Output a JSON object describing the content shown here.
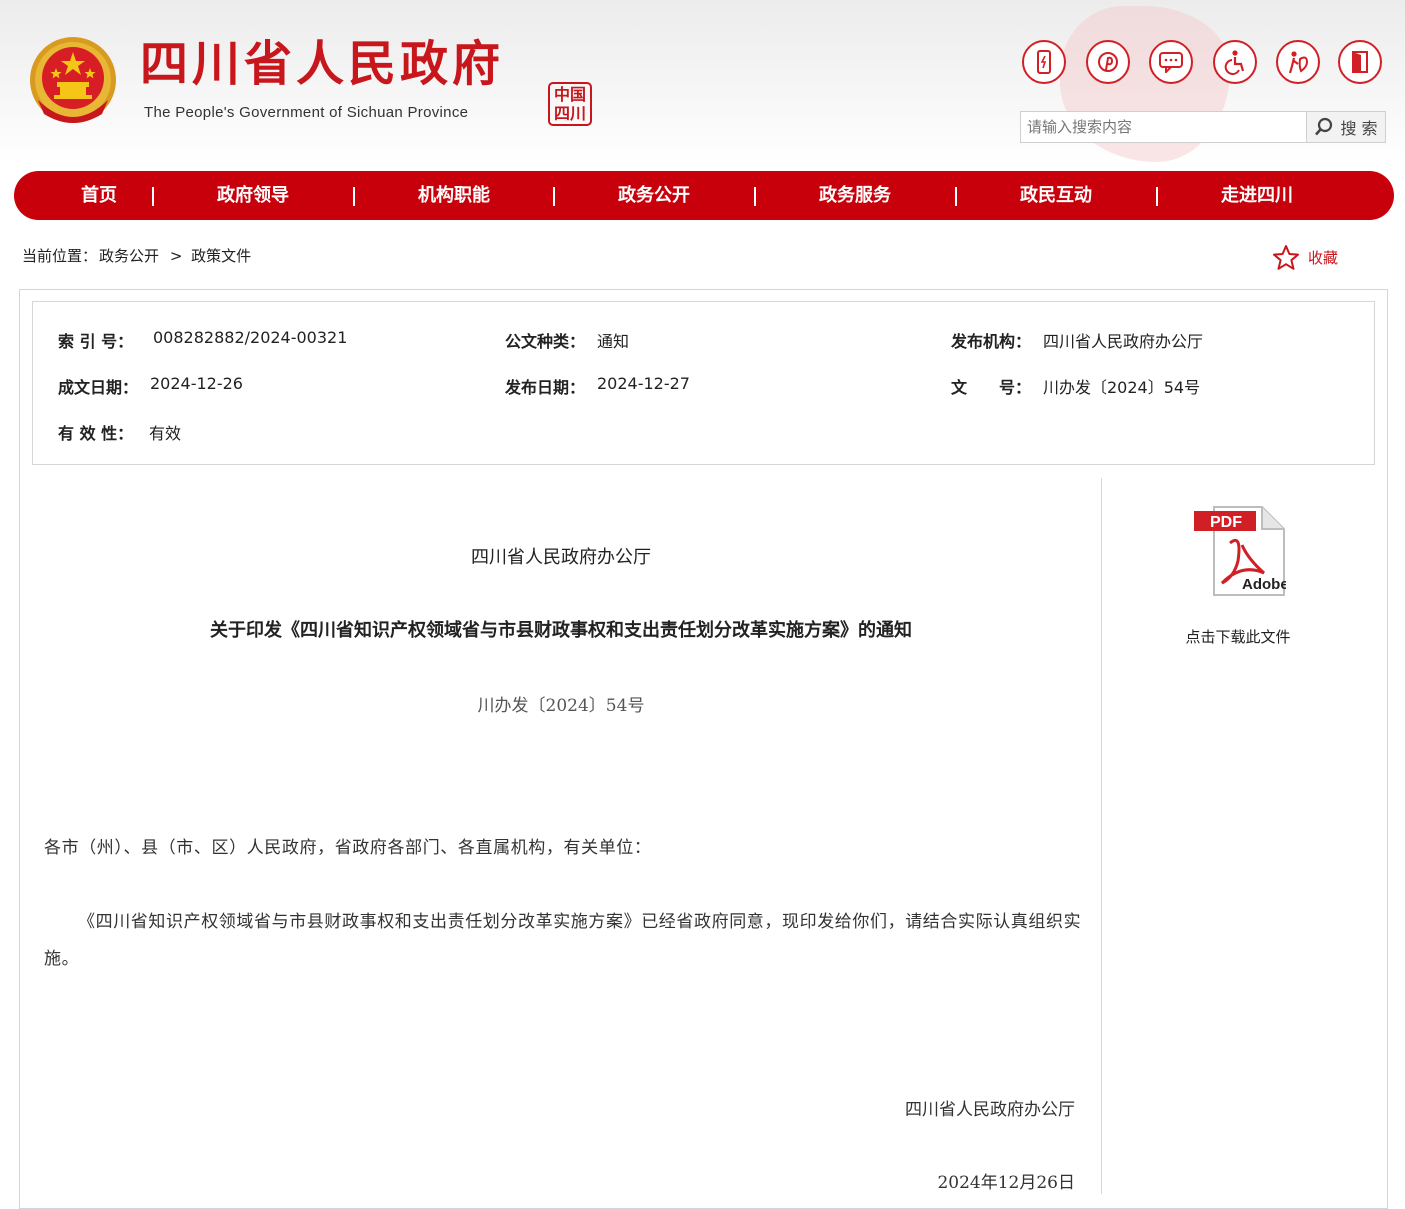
{
  "header": {
    "title": "四川省人民政府",
    "subtitle": "The People's Government of Sichuan Province",
    "seal_text": [
      "中国",
      "四川"
    ],
    "tool_icons": [
      "mobile-icon",
      "pinterest-icon",
      "message-icon",
      "accessibility-icon",
      "elderly-care-icon",
      "exit-door-icon"
    ],
    "search": {
      "placeholder": "请输入搜索内容",
      "button_label": "搜 索"
    },
    "accent_color": "#c8000b"
  },
  "nav": {
    "items": [
      {
        "label": "首页"
      },
      {
        "label": "政府领导"
      },
      {
        "label": "机构职能"
      },
      {
        "label": "政务公开"
      },
      {
        "label": "政务服务"
      },
      {
        "label": "政民互动"
      },
      {
        "label": "走进四川"
      }
    ],
    "separator": "|"
  },
  "breadcrumb": {
    "prefix": "当前位置：",
    "items": [
      "政务公开",
      "政策文件"
    ],
    "separator": ">"
  },
  "favorite": {
    "label": "收藏"
  },
  "meta": {
    "index_label": "索 引 号：",
    "index_value": "008282882/2024-00321",
    "type_label": "公文种类：",
    "type_value": "通知",
    "issuer_label": "发布机构：",
    "issuer_value": "四川省人民政府办公厅",
    "created_label": "成文日期：",
    "created_value": "2024-12-26",
    "published_label": "发布日期：",
    "published_value": "2024-12-27",
    "docno_label": "文　　号：",
    "docno_value": "川办发〔2024〕54号",
    "validity_label": "有 效 性：",
    "validity_value": "有效"
  },
  "document": {
    "issuer": "四川省人民政府办公厅",
    "title": "关于印发《四川省知识产权领域省与市县财政事权和支出责任划分改革实施方案》的通知",
    "number": "川办发〔2024〕54号",
    "salutation": "各市（州）、县（市、区）人民政府，省政府各部门、各直属机构，有关单位：",
    "body": "《四川省知识产权领域省与市县财政事权和支出责任划分改革实施方案》已经省政府同意，现印发给你们，请结合实际认真组织实施。",
    "signature": "四川省人民政府办公厅",
    "date": "2024年12月26日"
  },
  "download": {
    "badge": "PDF",
    "brand": "Adobe",
    "caption": "点击下载此文件"
  }
}
